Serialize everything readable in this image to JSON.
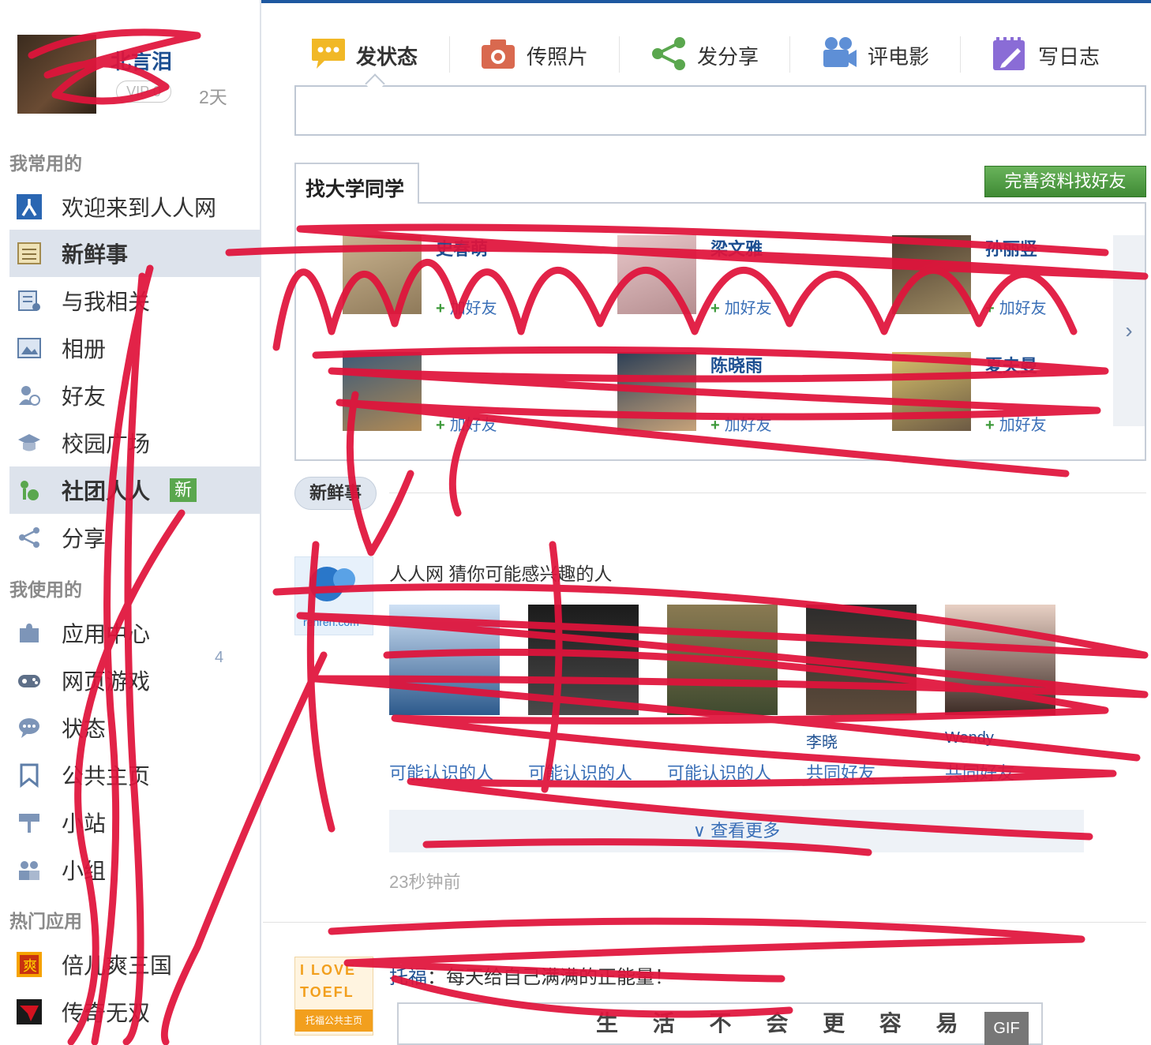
{
  "profile": {
    "name": "北言泪",
    "vip": "VIP 0",
    "days": "2天"
  },
  "sidebar": {
    "section_frequent": "我常用的",
    "section_used": "我使用的",
    "section_hot": "热门应用",
    "frequent": [
      {
        "label": "欢迎来到人人网",
        "icon": "renren-logo-icon"
      },
      {
        "label": "新鲜事",
        "icon": "newsfeed-icon"
      },
      {
        "label": "与我相关",
        "icon": "mentions-icon"
      },
      {
        "label": "相册",
        "icon": "album-icon"
      },
      {
        "label": "好友",
        "icon": "friends-icon"
      },
      {
        "label": "校园广场",
        "icon": "campus-icon"
      },
      {
        "label": "社团人人",
        "icon": "club-icon",
        "badge": "新"
      },
      {
        "label": "分享",
        "icon": "share-icon"
      }
    ],
    "used": [
      {
        "label": "应用中心",
        "icon": "puzzle-icon",
        "count": "4"
      },
      {
        "label": "网页游戏",
        "icon": "gamepad-icon"
      },
      {
        "label": "状态",
        "icon": "status-icon"
      },
      {
        "label": "公共主页",
        "icon": "bookmark-icon"
      },
      {
        "label": "小站",
        "icon": "signpost-icon"
      },
      {
        "label": "小组",
        "icon": "group-icon"
      }
    ],
    "hot": [
      {
        "label": "倍儿爽三国",
        "icon": "game-shuang-icon"
      },
      {
        "label": "传奇无双",
        "icon": "game-legend-icon"
      }
    ]
  },
  "publisher": {
    "tabs": [
      {
        "label": "发状态",
        "icon": "speech-bubble-icon"
      },
      {
        "label": "传照片",
        "icon": "camera-icon"
      },
      {
        "label": "发分享",
        "icon": "share-icon"
      },
      {
        "label": "评电影",
        "icon": "movie-camera-icon"
      },
      {
        "label": "写日志",
        "icon": "notebook-icon"
      }
    ]
  },
  "find_classmates": {
    "tab": "找大学同学",
    "button": "完善资料找好友",
    "people": [
      {
        "name": "史春萌",
        "info": "",
        "add": "加好友"
      },
      {
        "name": "梁文雅",
        "info": "",
        "add": "加好友"
      },
      {
        "name": "孙丽竖",
        "info": "",
        "add": "加好友"
      },
      {
        "name": "",
        "info": "",
        "add": "加好友"
      },
      {
        "name": "陈晓雨",
        "info": "",
        "add": "加好友"
      },
      {
        "name": "夏夫曼",
        "info": "",
        "add": "加好友"
      }
    ],
    "next_icon": "chevron-right-icon"
  },
  "feed": {
    "tab": "新鲜事",
    "item1": {
      "title": "人人网 猜你可能感兴趣的人",
      "logo_text": "renren.com",
      "recommendations": [
        {
          "name": "",
          "sub": "可能认识的人"
        },
        {
          "name": "",
          "sub": "可能认识的人"
        },
        {
          "name": "",
          "sub": "可能认识的人"
        },
        {
          "name": "李晓",
          "sub": "共同好友"
        },
        {
          "name": "Wendy",
          "sub": "共同好友"
        }
      ],
      "more": "查看更多",
      "time": "23秒钟前"
    },
    "item2": {
      "logo_line1": "I LOVE",
      "logo_line2": "TOEFL",
      "logo_caption": "托福公共主页",
      "author": "托福",
      "title_text": "每天给自己满满的正能量！",
      "image_text": "生 活 不 会 更 容 易",
      "gif": "GIF"
    }
  },
  "colors": {
    "accent": "#1e58a0",
    "link": "#1d4f91",
    "green": "#5aa74e",
    "scribble": "#e0133b"
  }
}
